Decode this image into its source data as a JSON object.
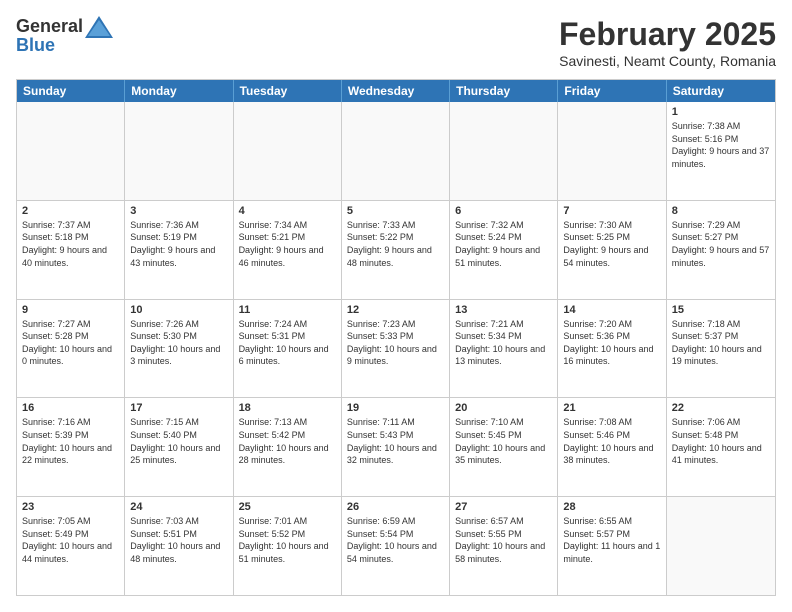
{
  "header": {
    "logo": {
      "general": "General",
      "blue": "Blue"
    },
    "month": "February 2025",
    "location": "Savinesti, Neamt County, Romania"
  },
  "weekdays": [
    "Sunday",
    "Monday",
    "Tuesday",
    "Wednesday",
    "Thursday",
    "Friday",
    "Saturday"
  ],
  "weeks": [
    [
      {
        "day": "",
        "empty": true
      },
      {
        "day": "",
        "empty": true
      },
      {
        "day": "",
        "empty": true
      },
      {
        "day": "",
        "empty": true
      },
      {
        "day": "",
        "empty": true
      },
      {
        "day": "",
        "empty": true
      },
      {
        "day": "1",
        "sunrise": "7:38 AM",
        "sunset": "5:16 PM",
        "daylight": "9 hours and 37 minutes."
      }
    ],
    [
      {
        "day": "2",
        "sunrise": "7:37 AM",
        "sunset": "5:18 PM",
        "daylight": "9 hours and 40 minutes."
      },
      {
        "day": "3",
        "sunrise": "7:36 AM",
        "sunset": "5:19 PM",
        "daylight": "9 hours and 43 minutes."
      },
      {
        "day": "4",
        "sunrise": "7:34 AM",
        "sunset": "5:21 PM",
        "daylight": "9 hours and 46 minutes."
      },
      {
        "day": "5",
        "sunrise": "7:33 AM",
        "sunset": "5:22 PM",
        "daylight": "9 hours and 48 minutes."
      },
      {
        "day": "6",
        "sunrise": "7:32 AM",
        "sunset": "5:24 PM",
        "daylight": "9 hours and 51 minutes."
      },
      {
        "day": "7",
        "sunrise": "7:30 AM",
        "sunset": "5:25 PM",
        "daylight": "9 hours and 54 minutes."
      },
      {
        "day": "8",
        "sunrise": "7:29 AM",
        "sunset": "5:27 PM",
        "daylight": "9 hours and 57 minutes."
      }
    ],
    [
      {
        "day": "9",
        "sunrise": "7:27 AM",
        "sunset": "5:28 PM",
        "daylight": "10 hours and 0 minutes."
      },
      {
        "day": "10",
        "sunrise": "7:26 AM",
        "sunset": "5:30 PM",
        "daylight": "10 hours and 3 minutes."
      },
      {
        "day": "11",
        "sunrise": "7:24 AM",
        "sunset": "5:31 PM",
        "daylight": "10 hours and 6 minutes."
      },
      {
        "day": "12",
        "sunrise": "7:23 AM",
        "sunset": "5:33 PM",
        "daylight": "10 hours and 9 minutes."
      },
      {
        "day": "13",
        "sunrise": "7:21 AM",
        "sunset": "5:34 PM",
        "daylight": "10 hours and 13 minutes."
      },
      {
        "day": "14",
        "sunrise": "7:20 AM",
        "sunset": "5:36 PM",
        "daylight": "10 hours and 16 minutes."
      },
      {
        "day": "15",
        "sunrise": "7:18 AM",
        "sunset": "5:37 PM",
        "daylight": "10 hours and 19 minutes."
      }
    ],
    [
      {
        "day": "16",
        "sunrise": "7:16 AM",
        "sunset": "5:39 PM",
        "daylight": "10 hours and 22 minutes."
      },
      {
        "day": "17",
        "sunrise": "7:15 AM",
        "sunset": "5:40 PM",
        "daylight": "10 hours and 25 minutes."
      },
      {
        "day": "18",
        "sunrise": "7:13 AM",
        "sunset": "5:42 PM",
        "daylight": "10 hours and 28 minutes."
      },
      {
        "day": "19",
        "sunrise": "7:11 AM",
        "sunset": "5:43 PM",
        "daylight": "10 hours and 32 minutes."
      },
      {
        "day": "20",
        "sunrise": "7:10 AM",
        "sunset": "5:45 PM",
        "daylight": "10 hours and 35 minutes."
      },
      {
        "day": "21",
        "sunrise": "7:08 AM",
        "sunset": "5:46 PM",
        "daylight": "10 hours and 38 minutes."
      },
      {
        "day": "22",
        "sunrise": "7:06 AM",
        "sunset": "5:48 PM",
        "daylight": "10 hours and 41 minutes."
      }
    ],
    [
      {
        "day": "23",
        "sunrise": "7:05 AM",
        "sunset": "5:49 PM",
        "daylight": "10 hours and 44 minutes."
      },
      {
        "day": "24",
        "sunrise": "7:03 AM",
        "sunset": "5:51 PM",
        "daylight": "10 hours and 48 minutes."
      },
      {
        "day": "25",
        "sunrise": "7:01 AM",
        "sunset": "5:52 PM",
        "daylight": "10 hours and 51 minutes."
      },
      {
        "day": "26",
        "sunrise": "6:59 AM",
        "sunset": "5:54 PM",
        "daylight": "10 hours and 54 minutes."
      },
      {
        "day": "27",
        "sunrise": "6:57 AM",
        "sunset": "5:55 PM",
        "daylight": "10 hours and 58 minutes."
      },
      {
        "day": "28",
        "sunrise": "6:55 AM",
        "sunset": "5:57 PM",
        "daylight": "11 hours and 1 minute."
      },
      {
        "day": "",
        "empty": true
      }
    ]
  ]
}
